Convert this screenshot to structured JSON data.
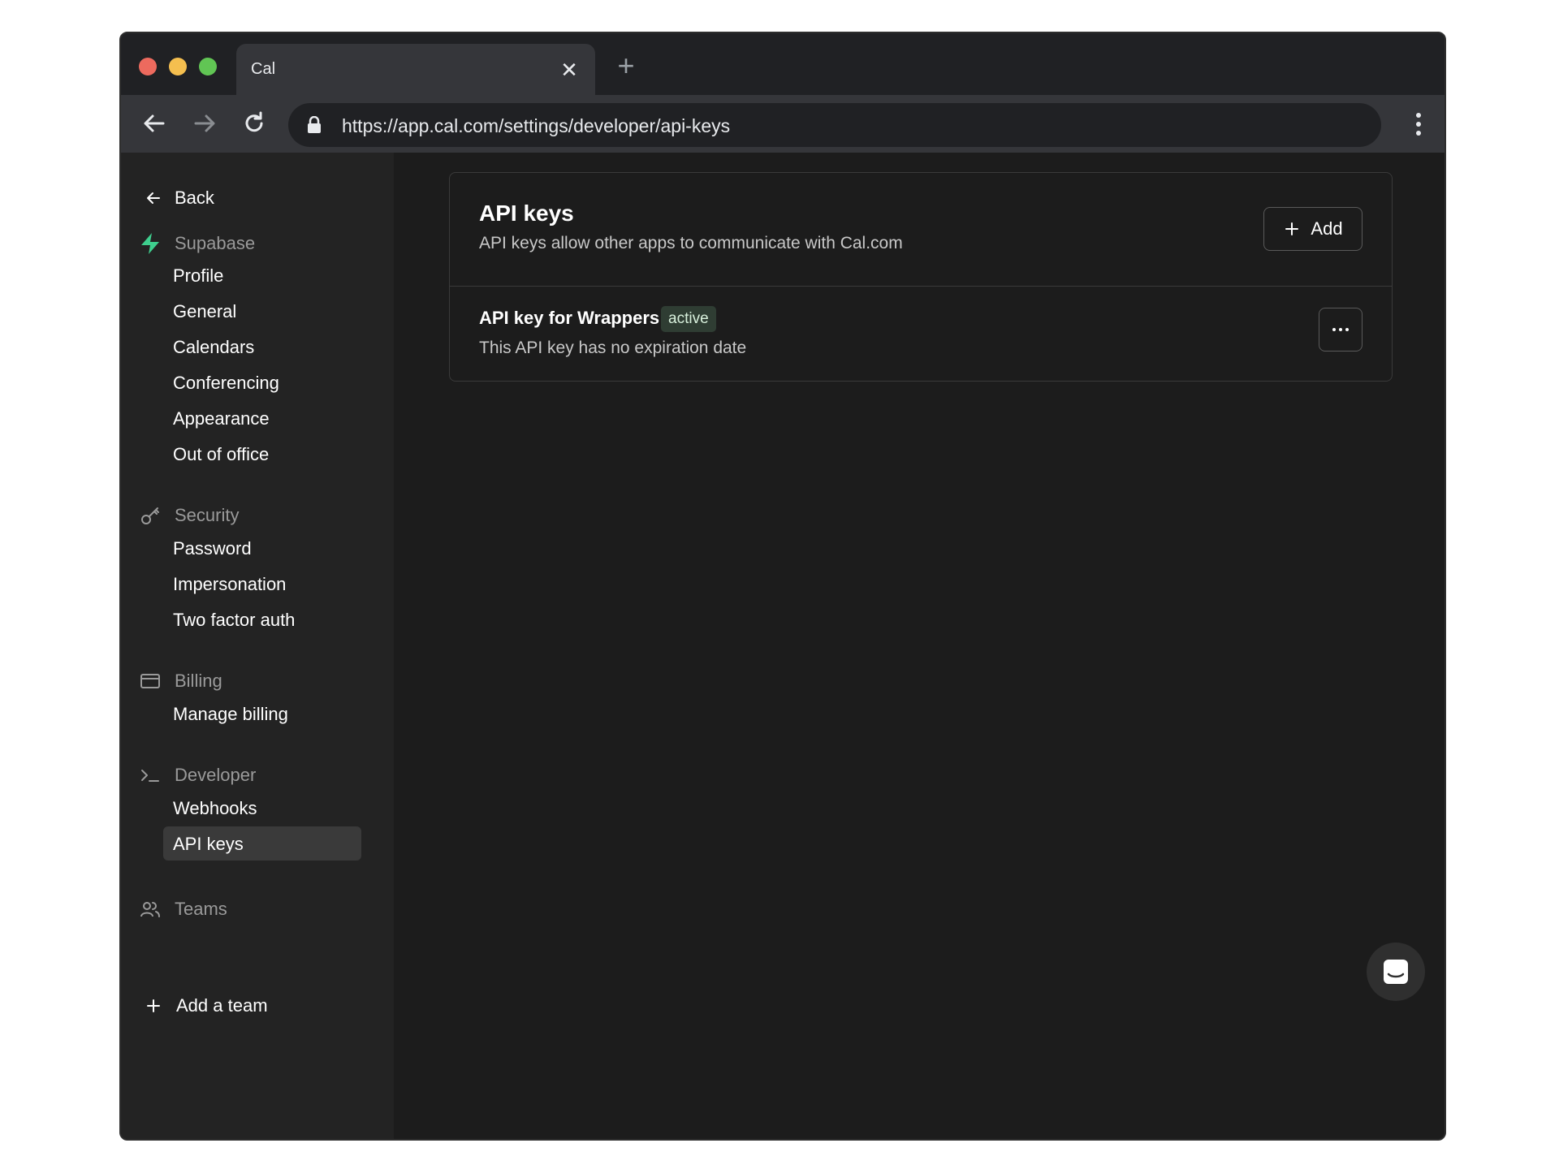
{
  "browser": {
    "tab_title": "Cal",
    "tab_close": "✕",
    "new_tab": "+",
    "url": "https://app.cal.com/settings/developer/api-keys"
  },
  "sidebar": {
    "back_label": "Back",
    "sections": [
      {
        "title": "Supabase",
        "icon": "supabase-logo-icon",
        "items": [
          "Profile",
          "General",
          "Calendars",
          "Conferencing",
          "Appearance",
          "Out of office"
        ]
      },
      {
        "title": "Security",
        "icon": "key-icon",
        "items": [
          "Password",
          "Impersonation",
          "Two factor auth"
        ]
      },
      {
        "title": "Billing",
        "icon": "credit-card-icon",
        "items": [
          "Manage billing"
        ]
      },
      {
        "title": "Developer",
        "icon": "terminal-icon",
        "items": [
          "Webhooks",
          "API keys"
        ]
      },
      {
        "title": "Teams",
        "icon": "users-icon",
        "items": []
      }
    ],
    "active_item": "API keys",
    "add_team_label": "Add a team"
  },
  "main": {
    "title": "API keys",
    "subtitle": "API keys allow other apps to communicate with Cal.com",
    "add_button_label": "Add",
    "keys": [
      {
        "name": "API key for Wrappers",
        "status": "active",
        "description": "This API key has no expiration date"
      }
    ]
  },
  "colors": {
    "brand_green": "#3ecf8e",
    "badge_bg": "#2f3d33",
    "background": "#1c1c1c",
    "sidebar_bg": "#232323"
  }
}
